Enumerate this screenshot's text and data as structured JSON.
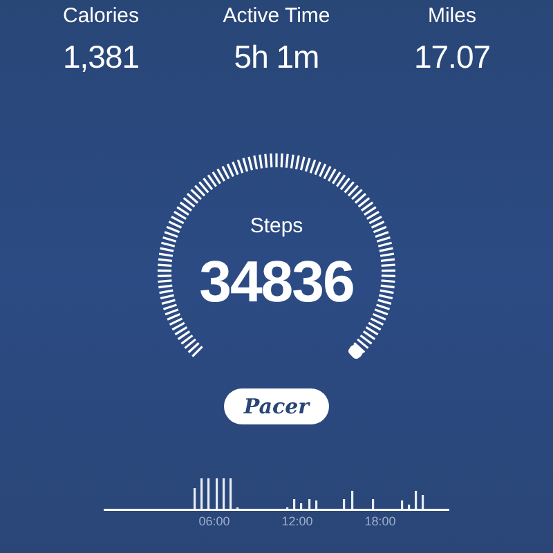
{
  "stats": [
    {
      "label": "Calories",
      "value": "1,381"
    },
    {
      "label": "Active Time",
      "value": "5h 1m"
    },
    {
      "label": "Miles",
      "value": "17.07"
    }
  ],
  "gauge": {
    "label": "Steps",
    "value": "34836"
  },
  "brand": {
    "label": "Pacer"
  },
  "activity": {
    "time_labels": [
      "06:00",
      "12:00",
      "18:00"
    ]
  }
}
